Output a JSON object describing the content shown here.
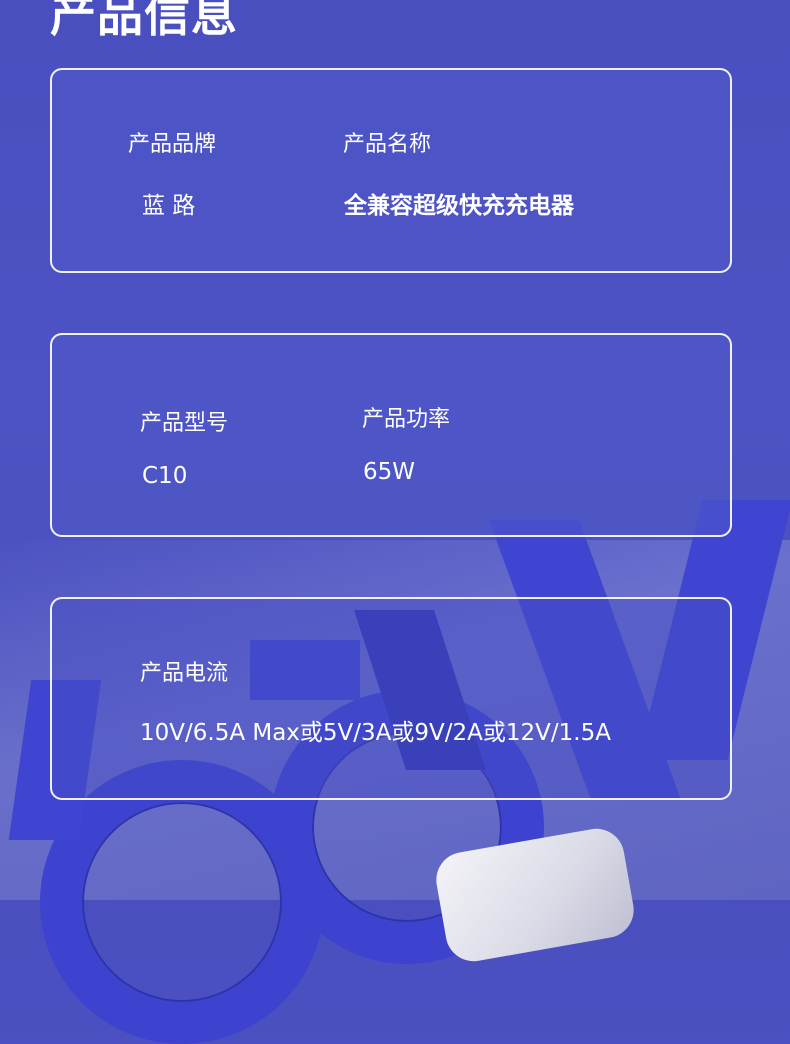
{
  "page": {
    "title": "产品信息"
  },
  "cards": [
    {
      "fields": [
        {
          "label": "产品品牌",
          "value": "蓝 路"
        },
        {
          "label": "产品名称",
          "value": "全兼容超级快充充电器"
        }
      ]
    },
    {
      "fields": [
        {
          "label": "产品型号",
          "value": "C10"
        },
        {
          "label": "产品功率",
          "value": "65W"
        }
      ]
    },
    {
      "fields": [
        {
          "label": "产品电流",
          "value": "10V/6.5A Max或5V/3A或9V/2A或12V/1.5A"
        }
      ]
    }
  ],
  "colors": {
    "background": "#4b50c2",
    "accent_blue": "#3d43cf",
    "text": "#ffffff"
  }
}
